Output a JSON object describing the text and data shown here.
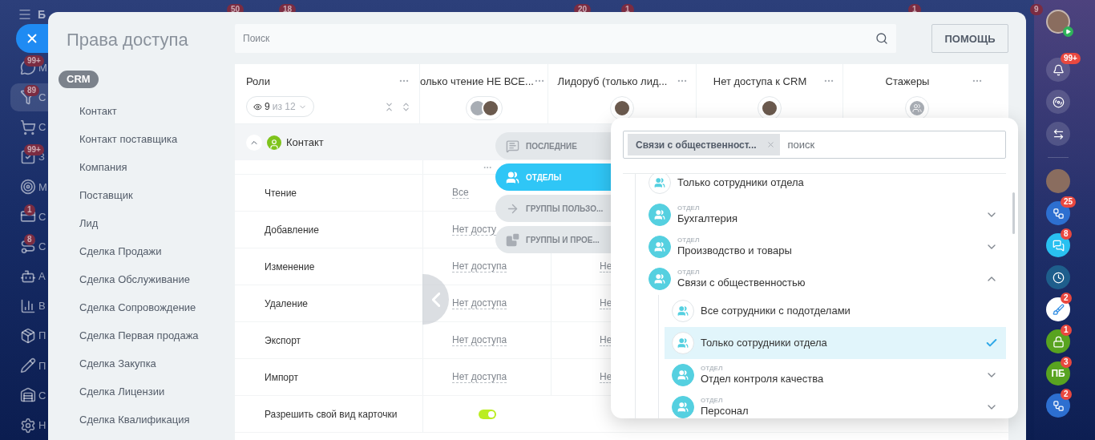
{
  "app_background": {
    "brand_letter": "Б",
    "top_badges": [
      "50",
      "18",
      "20",
      "1",
      "1",
      "9"
    ],
    "left_menu": [
      {
        "kind": "chat",
        "letter": "М",
        "badge": "99+",
        "selected": false
      },
      {
        "kind": "funnel",
        "letter": "С",
        "badge": "89",
        "selected": true
      },
      {
        "kind": "cart",
        "letter": "С",
        "selected": false
      },
      {
        "kind": "tasks",
        "letter": "З",
        "badge": "99+",
        "selected": false
      },
      {
        "kind": "target",
        "letter": "М",
        "selected": false
      },
      {
        "kind": "card",
        "letter": "С",
        "badge": "1",
        "selected": false
      },
      {
        "kind": "route",
        "letter": "С",
        "badge": "8",
        "selected": false
      },
      {
        "kind": "robot",
        "letter": "А",
        "selected": false
      },
      {
        "kind": "chart",
        "letter": "В",
        "selected": false
      },
      {
        "kind": "box",
        "letter": "П",
        "selected": false
      },
      {
        "kind": "pencil",
        "letter": "П",
        "selected": false
      },
      {
        "kind": "store",
        "letter": "С",
        "selected": false
      },
      {
        "kind": "gear",
        "letter": "Н",
        "selected": false
      }
    ]
  },
  "panel": {
    "title": "Права доступа",
    "search": {
      "placeholder": "Поиск"
    },
    "help_button": "ПОМОЩЬ",
    "nav": {
      "group": "CRM",
      "items": [
        "Контакт",
        "Контакт поставщика",
        "Компания",
        "Поставщик",
        "Лид",
        "Сделка Продажи",
        "Сделка Обслуживание",
        "Сделка Сопровождение",
        "Сделка Первая продажа",
        "Сделка Закупка",
        "Сделка Лицензии",
        "Сделка Квалификация"
      ]
    }
  },
  "table": {
    "roles_header": {
      "title": "Роли",
      "visible": "9",
      "total": "из 12"
    },
    "columns": [
      {
        "title": "олько чтение НЕ ВСЕ...",
        "avatars": [
          {
            "kind": "generic"
          },
          {
            "kind": "photo"
          }
        ]
      },
      {
        "title": "Лидоруб (только лид...",
        "avatars": [
          {
            "kind": "photo"
          }
        ]
      },
      {
        "title": "Нет доступа к CRM",
        "avatars": [
          {
            "kind": "photo"
          }
        ]
      },
      {
        "title": "Стажеры",
        "avatars": [
          {
            "kind": "group"
          }
        ]
      }
    ],
    "section": {
      "title": "Контакт",
      "expanded": true
    },
    "rows": [
      {
        "kind": "select",
        "label": "Чтение",
        "cells": [
          "Все"
        ]
      },
      {
        "kind": "select",
        "label": "Добавление",
        "cells": [
          "Нет досту"
        ]
      },
      {
        "kind": "select",
        "label": "Изменение",
        "cells": [
          "Нет доступа",
          "Не"
        ]
      },
      {
        "kind": "select",
        "label": "Удаление",
        "cells": [
          "Нет доступа",
          "Не"
        ]
      },
      {
        "kind": "select",
        "label": "Экспорт",
        "cells": [
          "Нет доступа",
          "Не"
        ]
      },
      {
        "kind": "select",
        "label": "Импорт",
        "cells": [
          "Нет доступа",
          "Не"
        ]
      },
      {
        "kind": "toggle",
        "label": "Разрешить свой вид карточки",
        "on": true
      }
    ]
  },
  "selector_tabs": [
    {
      "kind": "recent",
      "label": "ПОСЛЕДНИЕ",
      "selected": false
    },
    {
      "kind": "departments",
      "label": "ОТДЕЛЫ",
      "selected": true
    },
    {
      "kind": "user-groups",
      "label": "ГРУППЫ ПОЛЬЗО...",
      "selected": false
    },
    {
      "kind": "projects",
      "label": "ГРУППЫ И ПРОЕ...",
      "selected": false
    }
  ],
  "selector": {
    "chip": "Связи с общественност...",
    "search_placeholder": "поиск",
    "tree": [
      {
        "kind": "option",
        "label": "Только сотрудники отдела",
        "selected": false
      },
      {
        "kind": "department",
        "category": "ОТДЕЛ",
        "label": "Бухгалтерия",
        "expanded": false,
        "selected": false
      },
      {
        "kind": "department",
        "category": "ОТДЕЛ",
        "label": "Производство и товары",
        "expanded": false,
        "selected": false
      },
      {
        "kind": "department",
        "category": "ОТДЕЛ",
        "label": "Связи с общественностью",
        "expanded": true,
        "selected": false,
        "children": [
          {
            "kind": "option",
            "label": "Все сотрудники с подотделами",
            "selected": false
          },
          {
            "kind": "option",
            "label": "Только сотрудники отдела",
            "selected": true
          },
          {
            "kind": "department",
            "category": "ОТДЕЛ",
            "label": "Отдел контроля качества",
            "expanded": false,
            "selected": false
          },
          {
            "kind": "department",
            "category": "ОТДЕЛ",
            "label": "Персонал",
            "expanded": false,
            "selected": false
          }
        ]
      }
    ]
  },
  "right_bar": [
    {
      "kind": "avatar"
    },
    {
      "kind": "bell",
      "badge": "99+"
    },
    {
      "kind": "spiral"
    },
    {
      "kind": "chat-swap"
    },
    {
      "kind": "divider"
    },
    {
      "kind": "avatar"
    },
    {
      "kind": "flow",
      "badge": "25"
    },
    {
      "kind": "messages",
      "badge": "8"
    },
    {
      "kind": "user-clock"
    },
    {
      "kind": "broom",
      "badge": "2"
    },
    {
      "kind": "lock",
      "badge": "1"
    },
    {
      "kind": "letters",
      "label": "ПБ",
      "badge": "3"
    },
    {
      "kind": "flow",
      "badge": "2"
    }
  ]
}
